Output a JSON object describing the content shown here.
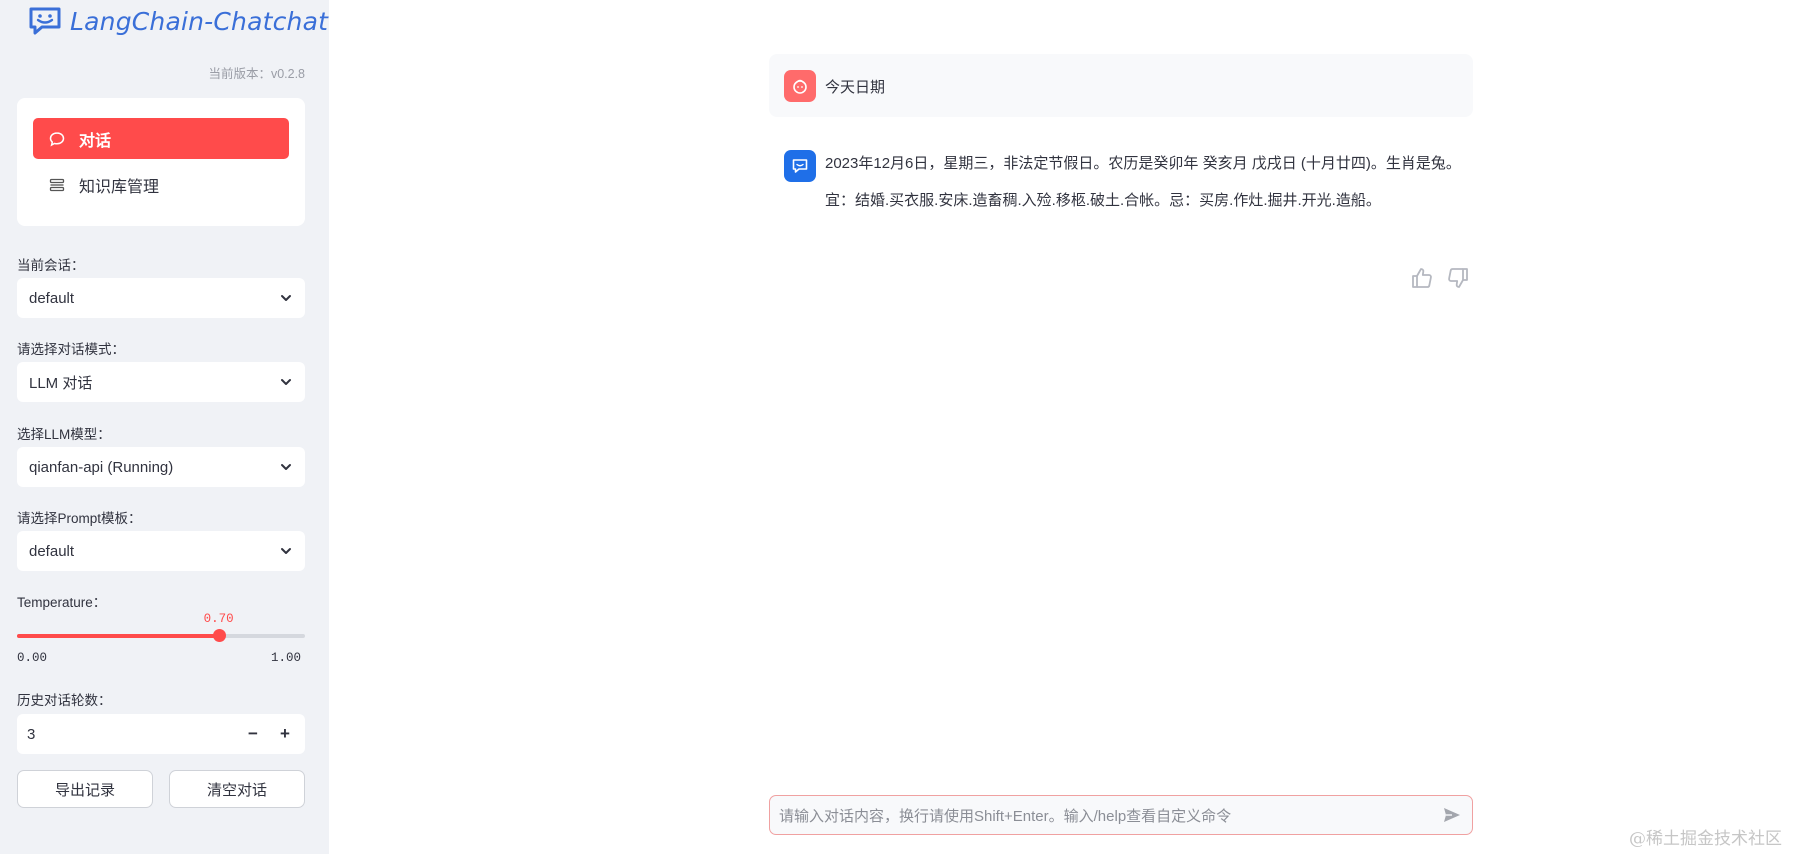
{
  "app": {
    "logo_text": "LangChain-Chatchat",
    "version_text": "当前版本：v0.2.8"
  },
  "nav": {
    "items": [
      {
        "label": "对话",
        "icon": "chat-bubble-icon",
        "active": true
      },
      {
        "label": "知识库管理",
        "icon": "list-icon",
        "active": false
      }
    ]
  },
  "sidebar": {
    "session": {
      "label": "当前会话：",
      "value": "default"
    },
    "mode": {
      "label": "请选择对话模式：",
      "value": "LLM 对话"
    },
    "model": {
      "label": "选择LLM模型：",
      "value": "qianfan-api (Running)"
    },
    "prompt": {
      "label": "请选择Prompt模板：",
      "value": "default"
    },
    "temperature": {
      "label": "Temperature：",
      "value": 0.7,
      "value_text": "0.70",
      "min_text": "0.00",
      "max_text": "1.00"
    },
    "history": {
      "label": "历史对话轮数：",
      "value": "3",
      "minus": "−",
      "plus": "+"
    },
    "buttons": {
      "export": "导出记录",
      "clear": "清空对话"
    }
  },
  "chat": {
    "messages": [
      {
        "role": "user",
        "text": "今天日期"
      },
      {
        "role": "assistant",
        "paragraphs": [
          "2023年12月6日，星期三，非法定节假日。农历是癸卯年 癸亥月 戊戌日 (十月廿四)。生肖是兔。",
          "宜：结婚.买衣服.安床.造畜稠.入殓.移柩.破土.合帐。忌：买房.作灶.掘井.开光.造船。"
        ]
      }
    ],
    "input": {
      "placeholder": "请输入对话内容，换行请使用Shift+Enter。输入/help查看自定义命令"
    }
  },
  "watermark": "@稀土掘金技术社区",
  "colors": {
    "accent": "#ff4b4b",
    "brand_blue": "#3a6fd8",
    "bot_avatar": "#1f6fe8",
    "user_avatar": "#ff6b6b",
    "sidebar_bg": "#f0f2f6"
  }
}
